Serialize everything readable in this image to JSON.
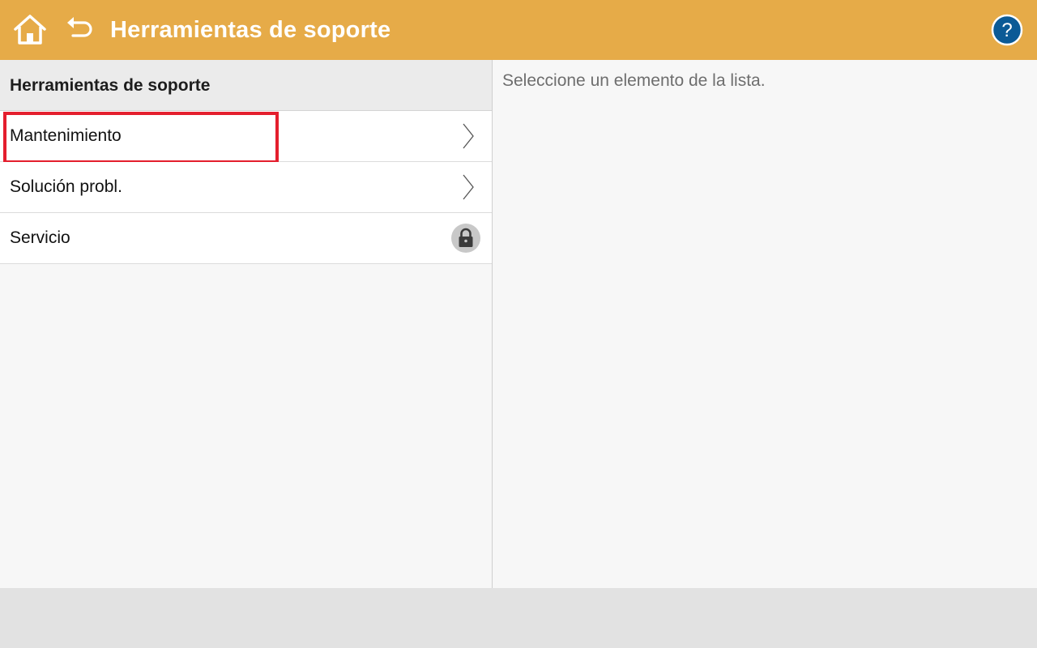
{
  "header": {
    "title": "Herramientas de soporte",
    "home_icon": "home-icon",
    "back_icon": "back-arrow-icon",
    "help_icon": "help-icon",
    "help_glyph": "?"
  },
  "left_panel": {
    "header": "Herramientas de soporte",
    "items": [
      {
        "label": "Mantenimiento",
        "icon": "chevron-right-icon",
        "highlighted": true
      },
      {
        "label": "Solución probl.",
        "icon": "chevron-right-icon"
      },
      {
        "label": "Servicio",
        "icon": "lock-icon"
      }
    ]
  },
  "right_panel": {
    "hint": "Seleccione un elemento de la lista."
  },
  "colors": {
    "header_bg": "#e6ab48",
    "help_blue": "#0b5a96",
    "highlight": "#e41e2d"
  }
}
